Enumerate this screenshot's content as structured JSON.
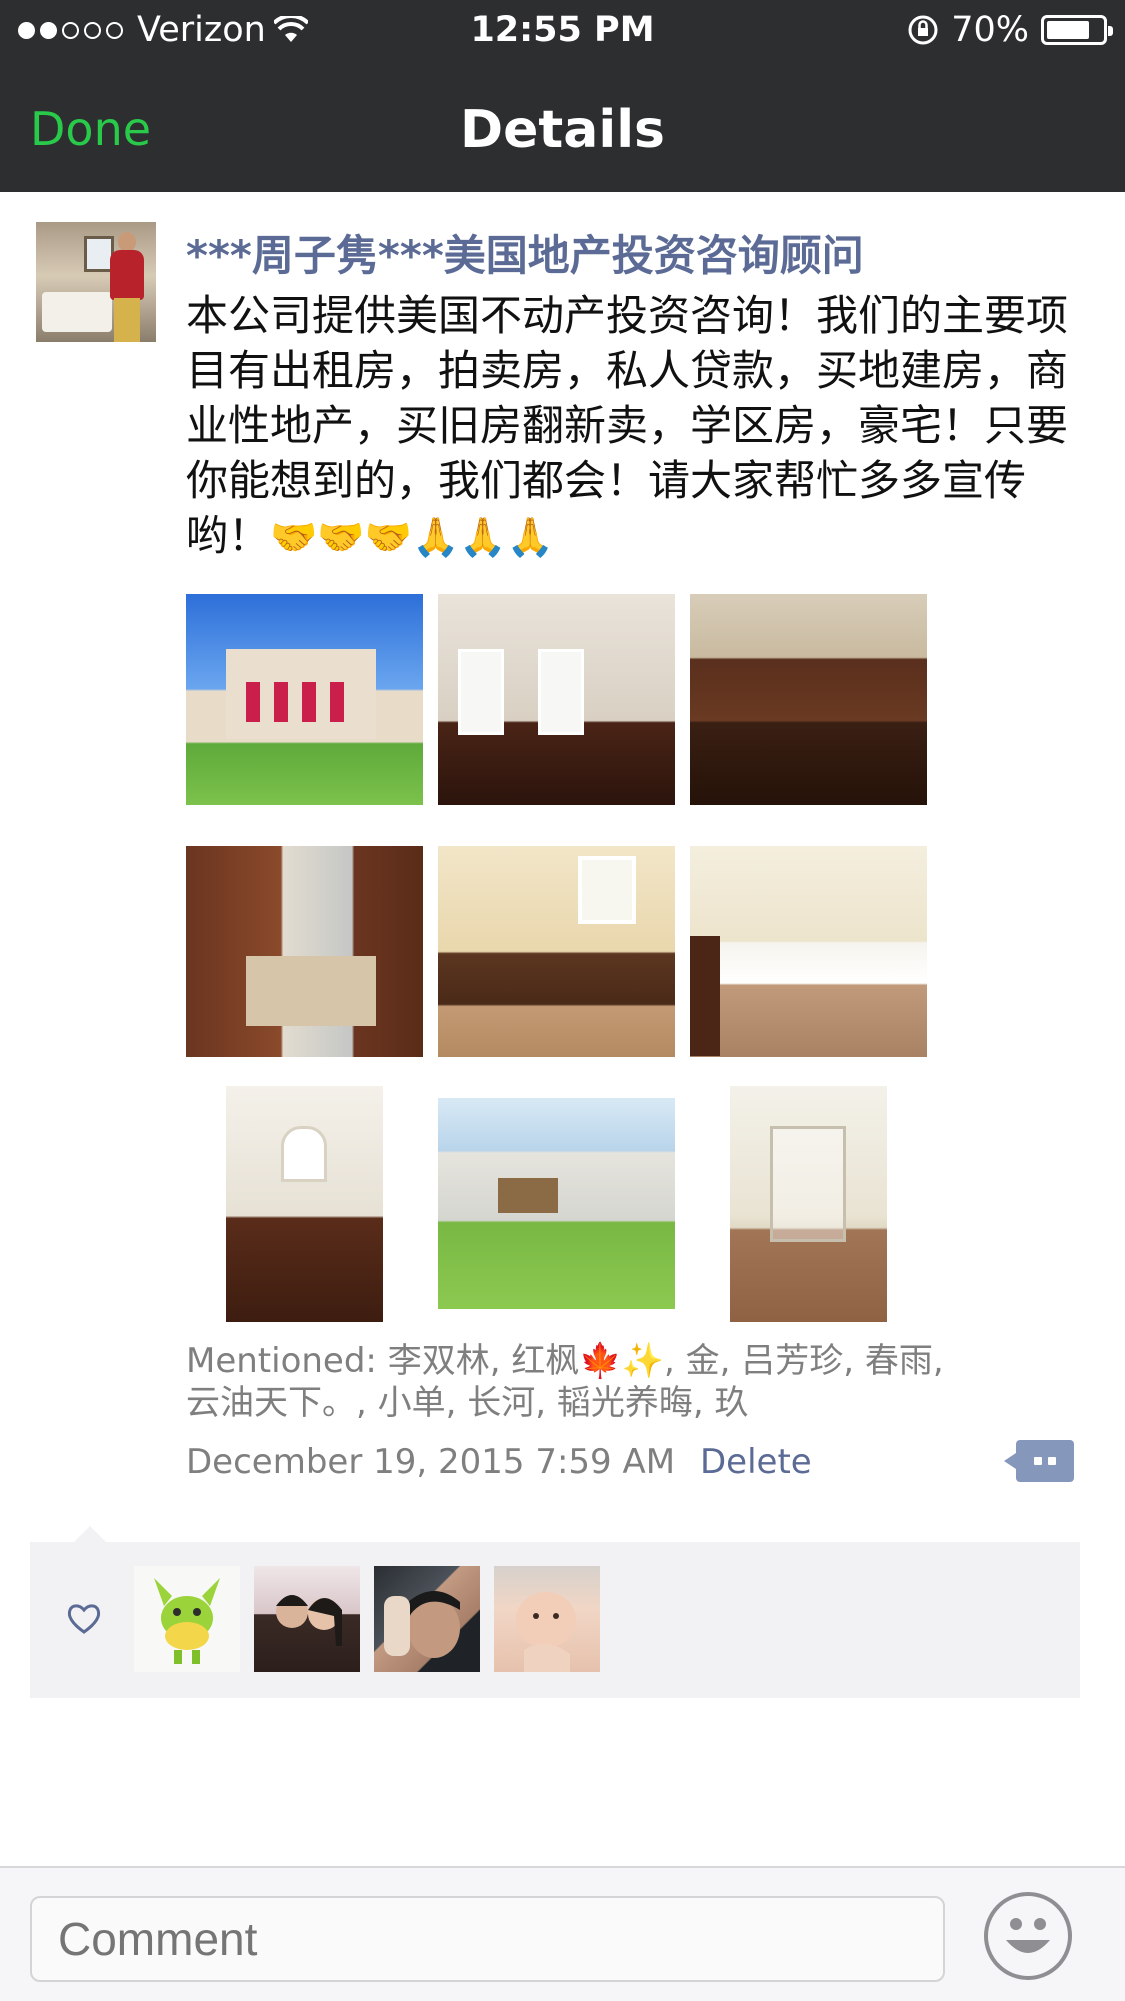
{
  "status_bar": {
    "carrier": "Verizon",
    "time": "12:55 PM",
    "battery": "70%",
    "signal_filled": 2,
    "signal_total": 5
  },
  "nav": {
    "left_button": "Done",
    "title": "Details",
    "accent_color": "#29c94a"
  },
  "post": {
    "author": "***周子隽***美国地产投资咨询顾问",
    "text": "本公司提供美国不动产投资咨询！我们的主要项目有出租房，拍卖房，私人贷款，买地建房，商业性地产，买旧房翻新卖，学区房，豪宅！只要你能想到的，我们都会！请大家帮忙多多宣传哟！",
    "emojis": "🤝🤝🤝🙏🙏🙏",
    "photos": [
      {
        "name": "house-exterior"
      },
      {
        "name": "empty-room"
      },
      {
        "name": "kitchen-dining"
      },
      {
        "name": "kitchen-island"
      },
      {
        "name": "bathroom-vanity"
      },
      {
        "name": "corner-bathtub"
      },
      {
        "name": "foyer-staircase"
      },
      {
        "name": "backyard"
      },
      {
        "name": "glass-shower"
      }
    ],
    "mentioned_label": "Mentioned:",
    "mentioned": "李双林, 红枫🍁✨, 金, 吕芳珍, 春雨, 云油天下。, 小单, 长河, 韬光养晦, 玖",
    "timestamp": "December 19, 2015 7:59 AM",
    "delete_label": "Delete"
  },
  "likes": {
    "icon": "heart-icon",
    "avatars": [
      "liker-cartoon-donkey",
      "liker-couple",
      "liker-man",
      "liker-baby"
    ]
  },
  "comment_bar": {
    "placeholder": "Comment",
    "emoji_icon": "smiley-icon"
  }
}
